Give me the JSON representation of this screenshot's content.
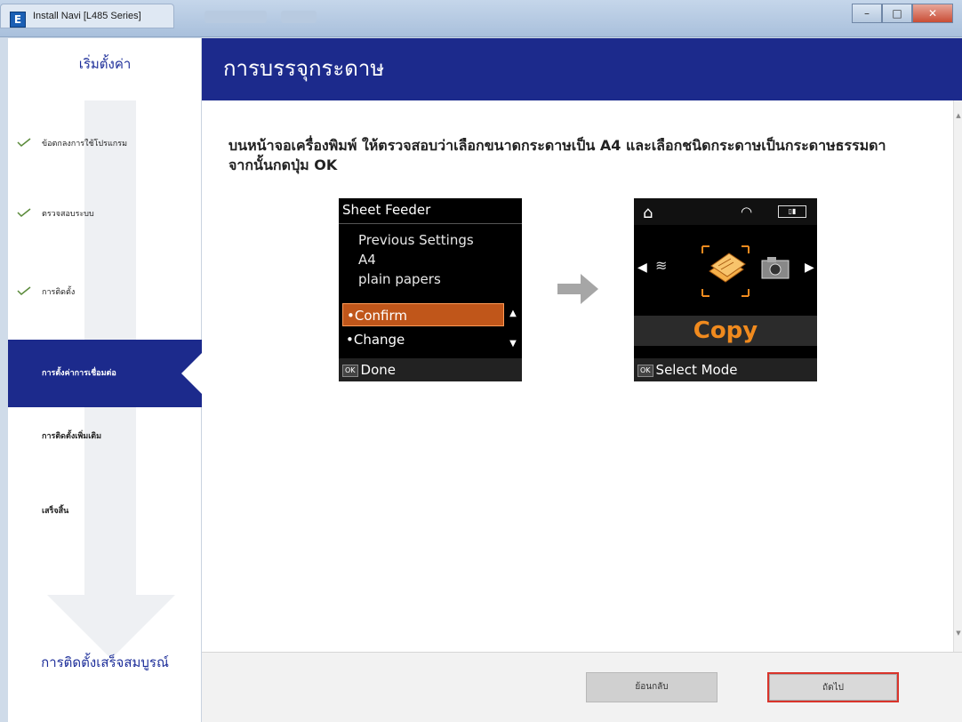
{
  "window": {
    "title": "Install Navi [L485 Series]",
    "app_icon_letter": "E"
  },
  "sidebar": {
    "top_label": "เริ่มตั้งค่า",
    "steps": [
      {
        "label": "ข้อตกลงการใช้โปรแกรม",
        "state": "done"
      },
      {
        "label": "ตรวจสอบระบบ",
        "state": "done"
      },
      {
        "label": "การติดตั้ง",
        "state": "done"
      },
      {
        "label": "การตั้งค่าการเชื่อมต่อ",
        "state": "active"
      },
      {
        "label": "การติดตั้งเพิ่มเติม",
        "state": "pending"
      },
      {
        "label": "เสร็จสิ้น",
        "state": "pending"
      }
    ],
    "bottom_label": "การติดตั้งเสร็จสมบูรณ์"
  },
  "main": {
    "title": "การบรรจุกระดาษ",
    "instruction": "บนหน้าจอเครื่องพิมพ์ ให้ตรวจสอบว่าเลือกขนาดกระดาษเป็น A4 และเลือกชนิดกระดาษเป็นกระดาษธรรมดา จากนั้นกดปุ่ม OK"
  },
  "lcd_left": {
    "header": "Sheet Feeder",
    "lines": [
      "Previous Settings",
      "A4",
      "plain papers"
    ],
    "options": [
      "Confirm",
      "Change"
    ],
    "selected_option": "Confirm",
    "ok_badge": "OK",
    "footer": "Done"
  },
  "lcd_right": {
    "ok_badge": "OK",
    "mode_label": "Copy",
    "footer": "Select Mode"
  },
  "footer": {
    "back_label": "ย้อนกลับ",
    "next_label": "ถัดไป"
  },
  "colors": {
    "header_blue": "#1c2a8c",
    "lcd_selected": "#c0561a",
    "copy_orange": "#f08a1e",
    "next_border": "#d9342b"
  }
}
